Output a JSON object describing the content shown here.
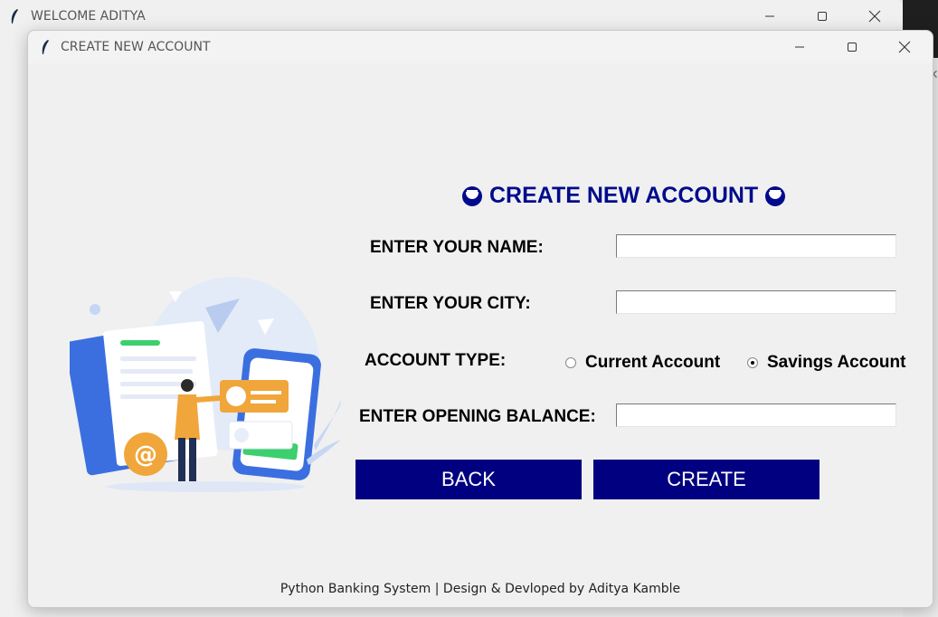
{
  "back_window": {
    "title": "WELCOME ADITYA"
  },
  "window": {
    "title": "CREATE NEW ACCOUNT",
    "icon": "feather-icon"
  },
  "form": {
    "heading": "CREATE NEW ACCOUNT",
    "heading_icon": "grinning-face-emoji",
    "name_label": "ENTER YOUR NAME:",
    "name_value": "",
    "city_label": "ENTER YOUR CITY:",
    "city_value": "",
    "account_type_label": "ACCOUNT TYPE:",
    "account_options": [
      {
        "label": "Current Account",
        "selected": false
      },
      {
        "label": "Savings Account",
        "selected": true
      }
    ],
    "balance_label": "ENTER OPENING BALANCE:",
    "balance_value": "",
    "back_button": "BACK",
    "create_button": "CREATE"
  },
  "footer": "Python Banking System | Design & Devloped by Aditya Kamble",
  "colors": {
    "accent": "#000080",
    "heading": "#000b8c",
    "illustration_blue": "#3b6fe0",
    "illustration_orange": "#f0a63a"
  }
}
